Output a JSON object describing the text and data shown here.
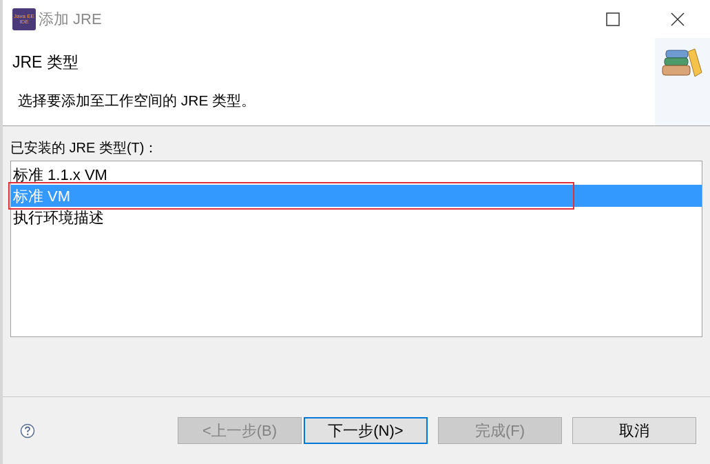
{
  "window": {
    "title": "添加 JRE",
    "icon_text": [
      "Java EE",
      "IDE"
    ]
  },
  "header": {
    "title": "JRE 类型",
    "description": "选择要添加至工作空间的 JRE 类型。"
  },
  "list": {
    "label": "已安装的 JRE 类型(T)：",
    "items": [
      {
        "label": "标准 1.1.x VM",
        "selected": false
      },
      {
        "label": "标准 VM",
        "selected": true
      },
      {
        "label": "执行环境描述",
        "selected": false
      }
    ]
  },
  "buttons": [
    {
      "label": "<上一步(B)",
      "disabled": true,
      "focused": false
    },
    {
      "label": "下一步(N)>",
      "disabled": false,
      "focused": true
    },
    {
      "label": "完成(F)",
      "disabled": true,
      "focused": false
    },
    {
      "label": "取消",
      "disabled": false,
      "focused": false
    }
  ]
}
